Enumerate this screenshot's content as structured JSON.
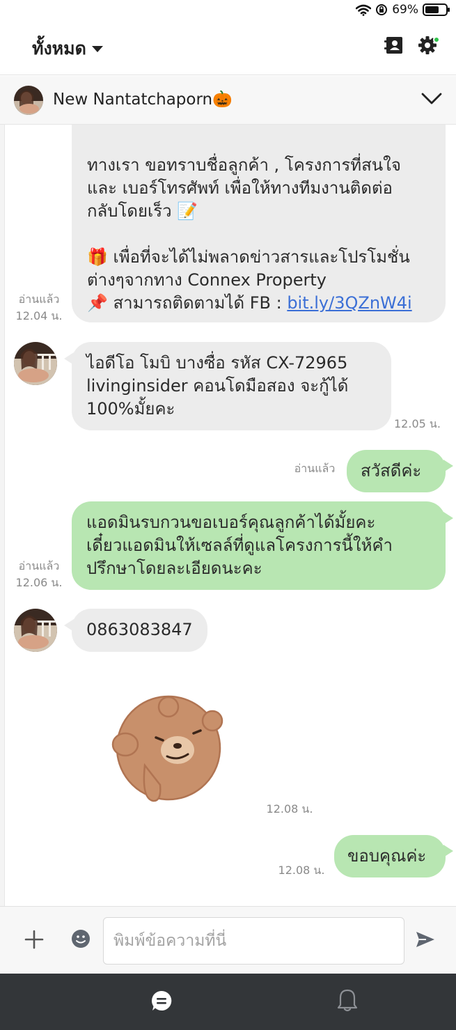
{
  "status_bar": {
    "battery_text": "69%",
    "battery_level": 0.69
  },
  "header": {
    "filter_label": "ทั้งหมด",
    "icons": [
      "contact-book-icon",
      "gear-icon"
    ],
    "accent_dot_color": "#2ec24a"
  },
  "chat_header": {
    "contact_name": "New Nantatchaporn🎃",
    "icons": [
      "chevron-down-icon"
    ]
  },
  "messages": [
    {
      "sender": "contact-admin",
      "direction": "outgoing",
      "lines": [
        "ทางเรา ขอทราบชื่อลูกค้า , โครงการที่สนใจ",
        "และ เบอร์โทรศัพท์ เพื่อให้ทางทีมงานติดต่อ",
        "กลับโดยเร็ว 📝",
        "🎁 เพื่อที่จะได้ไม่พลาดข่าวสารและโปรโมชั่น",
        "ต่างๆจากทาง Connex Property",
        "📌 สามารถติดตามได้ FB : "
      ],
      "link_text": "bit.ly/3QZnW4i",
      "read_label": "อ่านแล้ว",
      "time": "12.04 น."
    },
    {
      "direction": "incoming",
      "lines": [
        "ไอดีโอ โมบิ บางซื่อ รหัส CX-72965",
        "livinginsider คอนโดมือสอง จะกู้ได้",
        "100%มั้ยคะ"
      ],
      "time": "12.05 น."
    },
    {
      "direction": "outgoing",
      "lines": [
        "สวัสดีค่ะ"
      ],
      "read_label": "อ่านแล้ว"
    },
    {
      "direction": "outgoing",
      "lines": [
        "แอดมินรบกวนขอเบอร์คุณลูกค้าได้มั้ยคะ",
        "เดี๋ยวแอดมินให้เซลล์ที่ดูแลโครงการนี้ให้คำ",
        "ปรึกษาโดยละเอียดนะคะ"
      ],
      "read_label": "อ่านแล้ว",
      "time": "12.06 น."
    },
    {
      "direction": "incoming",
      "lines": [
        "0863083847"
      ]
    },
    {
      "direction": "incoming",
      "sticker": "brown-bear-sticker",
      "time": "12.08 น."
    },
    {
      "direction": "outgoing",
      "lines": [
        "ขอบคุณค่ะ"
      ],
      "time": "12.08 น."
    }
  ],
  "input": {
    "placeholder": "พิมพ์ข้อความที่นี่",
    "value": ""
  },
  "bottom_nav": {
    "items": [
      "chat-icon",
      "bell-icon"
    ]
  },
  "colors": {
    "incoming_bubble": "#ececec",
    "outgoing_bubble": "#b8e6b2",
    "link": "#3b6fd6",
    "nav_background": "#333639"
  }
}
